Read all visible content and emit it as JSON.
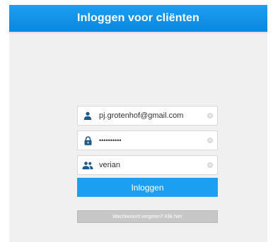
{
  "header": {
    "title": "Inloggen voor cliënten"
  },
  "form": {
    "email": {
      "icon": "user-icon",
      "value": "pj.grotenhof@gmail.com"
    },
    "password": {
      "icon": "lock-icon",
      "value": "••••••••••"
    },
    "organization": {
      "icon": "group-icon",
      "value": "verian"
    },
    "clear_icon": "clear-icon"
  },
  "buttons": {
    "login_label": "Inloggen",
    "forgot_label": "Wachtwoord vergeten? Klik hier"
  },
  "colors": {
    "header_blue": "#1097eb",
    "button_blue": "#1a9ff1",
    "icon_blue": "#1a5b8c",
    "background": "#f0f0f0",
    "disabled_grey": "#c7c7c7"
  }
}
